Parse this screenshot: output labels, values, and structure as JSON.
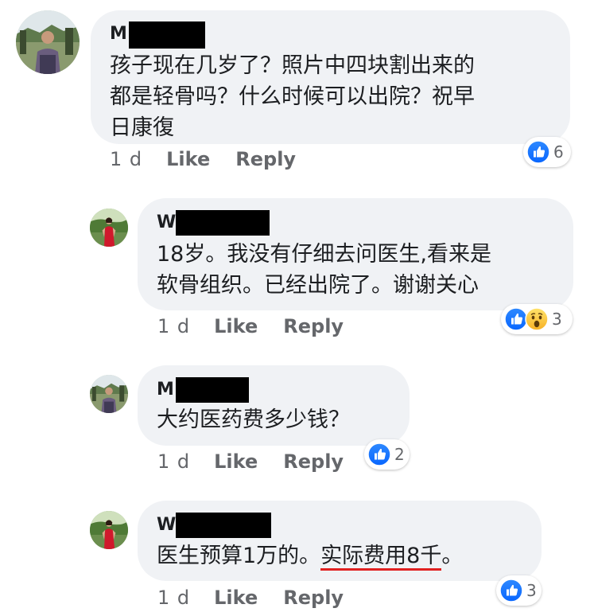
{
  "comments": [
    {
      "name_prefix": "M",
      "text_lines": [
        "孩子现在几岁了？照片中四块割出来的",
        "都是轻骨吗？什么时候可以出院？祝早",
        "日康復"
      ],
      "time": "1 d",
      "like_label": "Like",
      "reply_label": "Reply",
      "reaction_count": "6",
      "reaction_icons": [
        "like-icon"
      ]
    },
    {
      "name_prefix": "W",
      "text_lines": [
        "18岁。我没有仔细去问医生,看来是",
        "软骨组织。已经出院了。谢谢关心"
      ],
      "time": "1 d",
      "like_label": "Like",
      "reply_label": "Reply",
      "reaction_count": "3",
      "reaction_icons": [
        "like-icon",
        "wow-icon"
      ]
    },
    {
      "name_prefix": "M",
      "text_lines": [
        "大约医药费多少钱？"
      ],
      "time": "1 d",
      "like_label": "Like",
      "reply_label": "Reply",
      "reaction_count": "2",
      "reaction_icons": [
        "like-icon"
      ]
    },
    {
      "name_prefix": "W",
      "text_part1": "医生预算1万的。",
      "text_underlined": "实际费用8千",
      "text_part2": "。",
      "time": "1 d",
      "like_label": "Like",
      "reply_label": "Reply",
      "reaction_count": "3",
      "reaction_icons": [
        "like-icon"
      ]
    }
  ],
  "colors": {
    "bubble": "#f0f2f5",
    "like_blue": "#1877f2",
    "underline_red": "#e02020",
    "meta_gray": "#65676b"
  }
}
